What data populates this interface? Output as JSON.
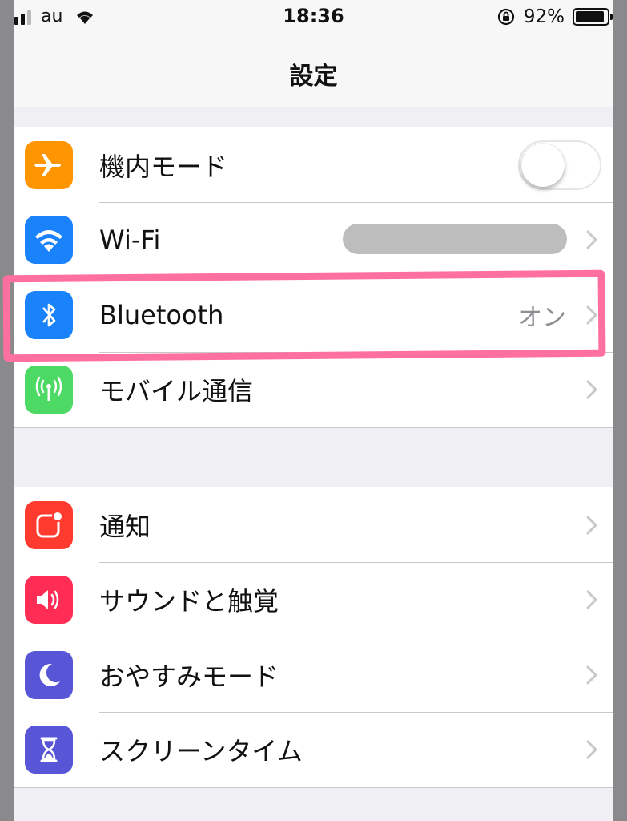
{
  "status_bar": {
    "carrier": "au",
    "time": "18:36",
    "battery_percent": "92%",
    "battery_level": 0.92
  },
  "nav": {
    "title": "設定"
  },
  "group1": [
    {
      "id": "airplane",
      "label": "機内モード",
      "icon": "airplane-icon",
      "icon_color": "#ff9500",
      "control": "toggle",
      "toggle_on": false
    },
    {
      "id": "wifi",
      "label": "Wi-Fi",
      "icon": "wifi-icon",
      "icon_color": "#1a82fb",
      "value": "",
      "value_redacted": true
    },
    {
      "id": "bluetooth",
      "label": "Bluetooth",
      "icon": "bluetooth-icon",
      "icon_color": "#1a82fb",
      "value": "オン"
    },
    {
      "id": "mobile",
      "label": "モバイル通信",
      "icon": "antenna-icon",
      "icon_color": "#4cd964"
    }
  ],
  "group2": [
    {
      "id": "notifications",
      "label": "通知",
      "icon": "notifications-icon",
      "icon_color": "#ff3b30"
    },
    {
      "id": "sounds",
      "label": "サウンドと触覚",
      "icon": "speaker-icon",
      "icon_color": "#ff2d55"
    },
    {
      "id": "dnd",
      "label": "おやすみモード",
      "icon": "moon-icon",
      "icon_color": "#5856d6"
    },
    {
      "id": "screentime",
      "label": "スクリーンタイム",
      "icon": "hourglass-icon",
      "icon_color": "#5856d6"
    }
  ],
  "colors": {
    "highlight": "#ff6fa0",
    "separator": "#c8c7cc",
    "background": "#efeff4"
  }
}
